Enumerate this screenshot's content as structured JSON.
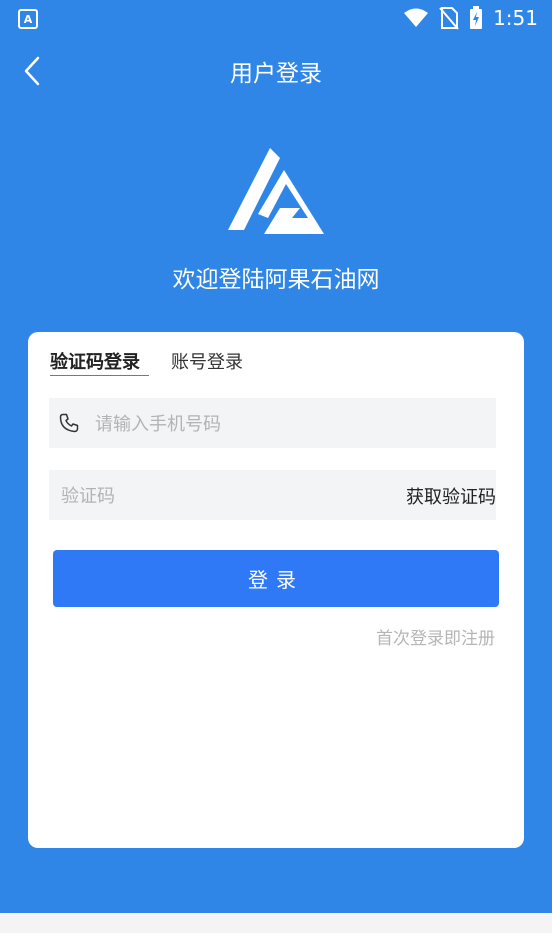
{
  "status_bar": {
    "time": "1:51",
    "app_badge": "A"
  },
  "header": {
    "title": "用户登录"
  },
  "hero": {
    "welcome": "欢迎登陆阿果石油网"
  },
  "tabs": [
    {
      "label": "验证码登录",
      "active": true
    },
    {
      "label": "账号登录",
      "active": false
    }
  ],
  "form": {
    "phone_placeholder": "请输入手机号码",
    "code_placeholder": "验证码",
    "get_code_label": "获取验证码",
    "login_label": "登录",
    "hint": "首次登录即注册"
  },
  "colors": {
    "primary_bg": "#2f86e6",
    "button": "#2f78f6",
    "tab_underline": "#e24c4c"
  }
}
